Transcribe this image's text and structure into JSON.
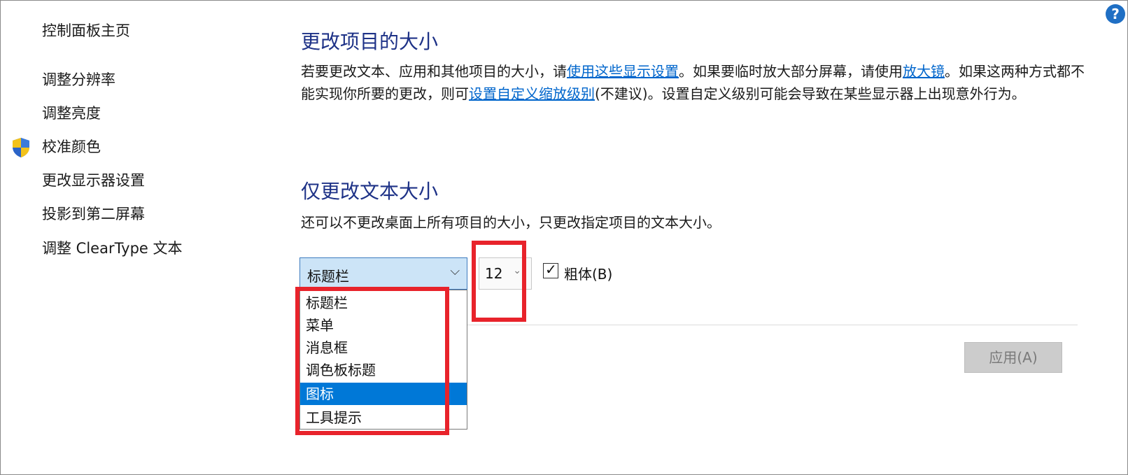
{
  "sidebar": {
    "items": [
      {
        "label": "控制面板主页"
      },
      {
        "label": "调整分辨率"
      },
      {
        "label": "调整亮度"
      },
      {
        "label": "校准颜色"
      },
      {
        "label": "更改显示器设置"
      },
      {
        "label": "投影到第二屏幕"
      },
      {
        "label": "调整 ClearType 文本"
      }
    ]
  },
  "help": {
    "label": "?"
  },
  "section1": {
    "title": "更改项目的大小",
    "p1": "若要更改文本、应用和其他项目的大小，请",
    "link1": "使用这些显示设置",
    "p2": "。如果要临时放大部分屏幕，请使用",
    "link2": "放大镜",
    "p3": "。如果这两种方式都不能实现你所要的更改，则可",
    "link3": "设置自定义缩放级别",
    "p4": "(不建议)。设置自定义级别可能会导致在某些显示器上出现意外行为。"
  },
  "section2": {
    "title": "仅更改文本大小",
    "desc": "还可以不更改桌面上所有项目的大小，只更改指定项目的文本大小。"
  },
  "combo": {
    "value": "标题栏",
    "chevron": "⌵"
  },
  "size": {
    "value": "12",
    "chevron": "⌄"
  },
  "bold": {
    "label": "粗体(B)",
    "checked": true,
    "mark": "✓"
  },
  "apply": {
    "label": "应用(A)"
  },
  "dropdown": {
    "items": [
      {
        "label": "标题栏"
      },
      {
        "label": "菜单"
      },
      {
        "label": "消息框"
      },
      {
        "label": "调色板标题"
      },
      {
        "label": "图标",
        "selected": true
      },
      {
        "label": "工具提示"
      }
    ]
  },
  "colors": {
    "heading": "#1e3287",
    "link": "#0066cc",
    "selected": "#0078d7",
    "annotation": "#e8232b"
  }
}
